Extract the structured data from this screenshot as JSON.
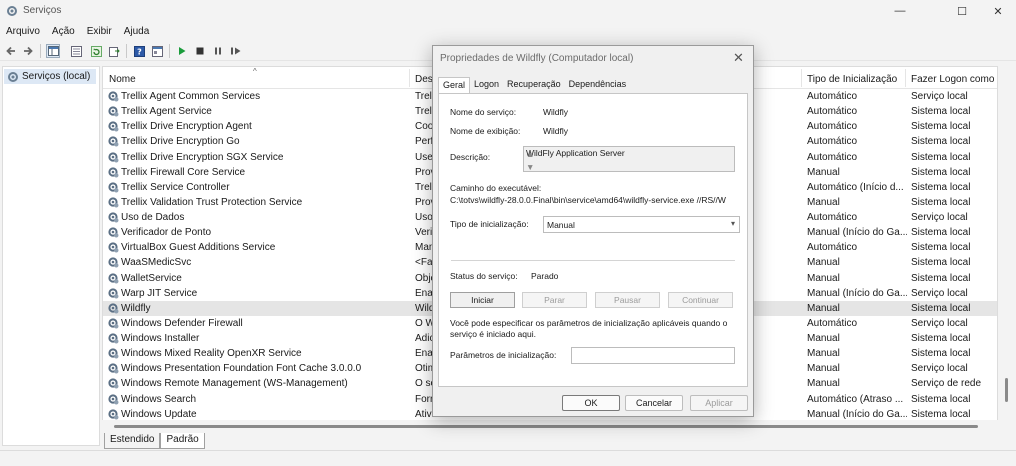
{
  "window": {
    "title": "Serviços",
    "minimize_glyph": "—",
    "maximize_glyph": "☐",
    "close_glyph": "✕"
  },
  "menu": [
    "Arquivo",
    "Ação",
    "Exibir",
    "Ajuda"
  ],
  "toolbar": {
    "icons": [
      "back-arrow-icon",
      "forward-arrow-icon",
      "console-tree-icon",
      "properties-icon",
      "refresh-icon",
      "export-list-icon",
      "help-icon",
      "mmc-view-icon",
      "start-service-icon",
      "stop-service-icon",
      "pause-service-icon",
      "restart-service-icon"
    ]
  },
  "tree": {
    "item": "Serviços (local)"
  },
  "list": {
    "columns": {
      "name": "Nome",
      "desc": "Desc",
      "startup": "Tipo de Inicialização",
      "logon": "Fazer Logon como"
    },
    "sort_glyph": "^",
    "rows": [
      {
        "name": "Trellix Agent Common Services",
        "desc": "Trell",
        "startup": "Automático",
        "logon": "Serviço local"
      },
      {
        "name": "Trellix Agent Service",
        "desc": "Trell",
        "startup": "Automático",
        "logon": "Sistema local"
      },
      {
        "name": "Trellix Drive Encryption Agent",
        "desc": "Coo",
        "startup": "Automático",
        "logon": "Sistema local"
      },
      {
        "name": "Trellix Drive Encryption Go",
        "desc": "Perf",
        "startup": "Automático",
        "logon": "Sistema local"
      },
      {
        "name": "Trellix Drive Encryption SGX Service",
        "desc": "Uses",
        "startup": "Automático",
        "logon": "Sistema local"
      },
      {
        "name": "Trellix Firewall Core Service",
        "desc": "Prov",
        "startup": "Manual",
        "logon": "Sistema local"
      },
      {
        "name": "Trellix Service Controller",
        "desc": "Trell",
        "startup": "Automático (Início d...",
        "logon": "Sistema local"
      },
      {
        "name": "Trellix Validation Trust Protection Service",
        "desc": "Prov",
        "startup": "Manual",
        "logon": "Sistema local"
      },
      {
        "name": "Uso de Dados",
        "desc": "Uso",
        "startup": "Automático",
        "logon": "Serviço local"
      },
      {
        "name": "Verificador de Ponto",
        "desc": "Verif",
        "startup": "Manual (Início do Ga...",
        "logon": "Sistema local"
      },
      {
        "name": "VirtualBox Guest Additions Service",
        "desc": "Man",
        "startup": "Automático",
        "logon": "Sistema local"
      },
      {
        "name": "WaaSMedicSvc",
        "desc": "<Fal",
        "startup": "Manual",
        "logon": "Sistema local"
      },
      {
        "name": "WalletService",
        "desc": "Obje",
        "startup": "Manual",
        "logon": "Sistema local"
      },
      {
        "name": "Warp JIT Service",
        "desc": "Enal",
        "startup": "Manual (Início do Ga...",
        "logon": "Serviço local"
      },
      {
        "name": "Wildfly",
        "desc": "Wild",
        "startup": "Manual",
        "logon": "Sistema local"
      },
      {
        "name": "Windows Defender Firewall",
        "desc": "O W",
        "startup": "Automático",
        "logon": "Serviço local"
      },
      {
        "name": "Windows Installer",
        "desc": "Adic",
        "startup": "Manual",
        "logon": "Sistema local"
      },
      {
        "name": "Windows Mixed Reality OpenXR Service",
        "desc": "Enal",
        "startup": "Manual",
        "logon": "Sistema local"
      },
      {
        "name": "Windows Presentation Foundation Font Cache 3.0.0.0",
        "desc": "Otim",
        "startup": "Manual",
        "logon": "Serviço local"
      },
      {
        "name": "Windows Remote Management (WS-Management)",
        "desc": "O se",
        "startup": "Manual",
        "logon": "Serviço de rede"
      },
      {
        "name": "Windows Search",
        "desc": "Forr",
        "startup": "Automático (Atraso ...",
        "logon": "Sistema local"
      },
      {
        "name": "Windows Update",
        "desc": "Ativa",
        "startup": "Manual (Início do Ga...",
        "logon": "Sistema local"
      }
    ]
  },
  "bottom_tabs": [
    "Estendido",
    "Padrão"
  ],
  "dialog": {
    "title": "Propriedades de Wildfly (Computador local)",
    "close_glyph": "✕",
    "tabs": [
      "Geral",
      "Logon",
      "Recuperação",
      "Dependências"
    ],
    "service_name_label": "Nome do serviço:",
    "service_name": "Wildfly",
    "display_name_label": "Nome de exibição:",
    "display_name": "Wildfly",
    "description_label": "Descrição:",
    "description": "WildFly Application Server",
    "exe_path_label": "Caminho do executável:",
    "exe_path": "C:\\totvs\\wildfly-28.0.0.Final\\bin\\service\\amd64\\wildfly-service.exe //RS//W",
    "startup_type_label": "Tipo de inicialização:",
    "startup_type": "Manual",
    "status_label": "Status do serviço:",
    "status_value": "Parado",
    "buttons": {
      "start": "Iniciar",
      "stop": "Parar",
      "pause": "Pausar",
      "resume": "Continuar"
    },
    "info_text_1": "Você pode especificar os parâmetros de inicialização aplicáveis quando o",
    "info_text_2": "serviço é iniciado aqui.",
    "params_label": "Parâmetros de inicialização:",
    "params_value": "",
    "ok": "OK",
    "cancel": "Cancelar",
    "apply": "Aplicar"
  }
}
